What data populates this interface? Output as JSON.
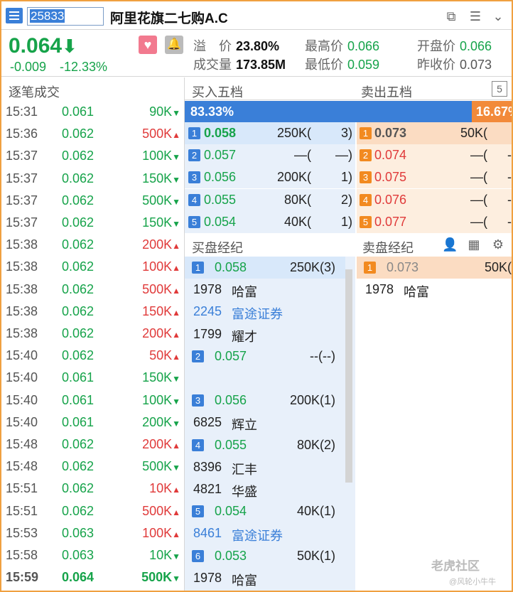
{
  "header": {
    "code": "25833",
    "name": "阿里花旗二七购A.C",
    "price": "0.064",
    "change": "-0.009",
    "change_pct": "-12.33%",
    "premium_label": "溢　价",
    "premium_value": "23.80%",
    "high_label": "最高价",
    "high_value": "0.066",
    "open_label": "开盘价",
    "open_value": "0.066",
    "volume_label": "成交量",
    "volume_value": "173.85M",
    "low_label": "最低价",
    "low_value": "0.059",
    "prev_label": "昨收价",
    "prev_value": "0.073"
  },
  "trades": {
    "title": "逐笔成交",
    "rows": [
      {
        "time": "15:31",
        "price": "0.061",
        "vol": "90K",
        "dir": "down"
      },
      {
        "time": "15:36",
        "price": "0.062",
        "vol": "500K",
        "dir": "up"
      },
      {
        "time": "15:37",
        "price": "0.062",
        "vol": "100K",
        "dir": "down"
      },
      {
        "time": "15:37",
        "price": "0.062",
        "vol": "150K",
        "dir": "down"
      },
      {
        "time": "15:37",
        "price": "0.062",
        "vol": "500K",
        "dir": "down"
      },
      {
        "time": "15:37",
        "price": "0.062",
        "vol": "150K",
        "dir": "down"
      },
      {
        "time": "15:38",
        "price": "0.062",
        "vol": "200K",
        "dir": "up"
      },
      {
        "time": "15:38",
        "price": "0.062",
        "vol": "100K",
        "dir": "up"
      },
      {
        "time": "15:38",
        "price": "0.062",
        "vol": "500K",
        "dir": "up"
      },
      {
        "time": "15:38",
        "price": "0.062",
        "vol": "150K",
        "dir": "up"
      },
      {
        "time": "15:38",
        "price": "0.062",
        "vol": "200K",
        "dir": "up"
      },
      {
        "time": "15:40",
        "price": "0.062",
        "vol": "50K",
        "dir": "up"
      },
      {
        "time": "15:40",
        "price": "0.061",
        "vol": "150K",
        "dir": "down"
      },
      {
        "time": "15:40",
        "price": "0.061",
        "vol": "100K",
        "dir": "down"
      },
      {
        "time": "15:40",
        "price": "0.061",
        "vol": "200K",
        "dir": "down"
      },
      {
        "time": "15:48",
        "price": "0.062",
        "vol": "200K",
        "dir": "up"
      },
      {
        "time": "15:48",
        "price": "0.062",
        "vol": "500K",
        "dir": "down"
      },
      {
        "time": "15:51",
        "price": "0.062",
        "vol": "10K",
        "dir": "up"
      },
      {
        "time": "15:51",
        "price": "0.062",
        "vol": "500K",
        "dir": "up"
      },
      {
        "time": "15:53",
        "price": "0.063",
        "vol": "100K",
        "dir": "up"
      },
      {
        "time": "15:58",
        "price": "0.063",
        "vol": "10K",
        "dir": "down"
      },
      {
        "time": "15:59",
        "price": "0.064",
        "vol": "500K",
        "dir": "down"
      }
    ]
  },
  "book": {
    "buy_title": "买入五档",
    "sell_title": "卖出五档",
    "level_btn": "5",
    "buy_ratio": "83.33%",
    "sell_ratio": "16.67%",
    "buy": [
      {
        "n": "1",
        "price": "0.058",
        "vol": "250K(",
        "cnt": "3)"
      },
      {
        "n": "2",
        "price": "0.057",
        "vol": "—(",
        "cnt": "—)"
      },
      {
        "n": "3",
        "price": "0.056",
        "vol": "200K(",
        "cnt": "1)"
      },
      {
        "n": "4",
        "price": "0.055",
        "vol": "80K(",
        "cnt": "2)"
      },
      {
        "n": "5",
        "price": "0.054",
        "vol": "40K(",
        "cnt": "1)"
      }
    ],
    "sell": [
      {
        "n": "1",
        "price": "0.073",
        "vol": "50K(",
        "cnt": ""
      },
      {
        "n": "2",
        "price": "0.074",
        "vol": "—(",
        "cnt": "-"
      },
      {
        "n": "3",
        "price": "0.075",
        "vol": "—(",
        "cnt": "-"
      },
      {
        "n": "4",
        "price": "0.076",
        "vol": "—(",
        "cnt": "-"
      },
      {
        "n": "5",
        "price": "0.077",
        "vol": "—(",
        "cnt": "-"
      }
    ]
  },
  "brokers": {
    "buy_title": "买盘经纪",
    "sell_title": "卖盘经纪",
    "buy": [
      {
        "type": "level",
        "n": "1",
        "price": "0.058",
        "vol": "250K(3)"
      },
      {
        "type": "broker",
        "id": "1978",
        "name": "哈富",
        "blue": false
      },
      {
        "type": "broker",
        "id": "2245",
        "name": "富途证券",
        "blue": true
      },
      {
        "type": "broker",
        "id": "1799",
        "name": "耀才",
        "blue": false
      },
      {
        "type": "level",
        "n": "2",
        "price": "0.057",
        "vol": "--(--)"
      },
      {
        "type": "empty"
      },
      {
        "type": "level",
        "n": "3",
        "price": "0.056",
        "vol": "200K(1)"
      },
      {
        "type": "broker",
        "id": "6825",
        "name": "辉立",
        "blue": false
      },
      {
        "type": "level",
        "n": "4",
        "price": "0.055",
        "vol": "80K(2)"
      },
      {
        "type": "broker",
        "id": "8396",
        "name": "汇丰",
        "blue": false
      },
      {
        "type": "broker",
        "id": "4821",
        "name": "华盛",
        "blue": false
      },
      {
        "type": "level",
        "n": "5",
        "price": "0.054",
        "vol": "40K(1)"
      },
      {
        "type": "broker",
        "id": "8461",
        "name": "富途证券",
        "blue": true
      },
      {
        "type": "level",
        "n": "6",
        "price": "0.053",
        "vol": "50K(1)"
      },
      {
        "type": "broker",
        "id": "1978",
        "name": "哈富",
        "blue": false
      }
    ],
    "sell": [
      {
        "type": "level",
        "n": "1",
        "price": "0.073",
        "vol": "50K("
      },
      {
        "type": "broker",
        "id": "1978",
        "name": "哈富",
        "blue": false
      }
    ]
  },
  "watermark": "老虎社区",
  "watermark_user": "@风轮小牛牛",
  "colors": {
    "up": "#e03a3a",
    "down": "#16a34a",
    "accent": "#3a7fd8",
    "sell": "#f28a20"
  }
}
